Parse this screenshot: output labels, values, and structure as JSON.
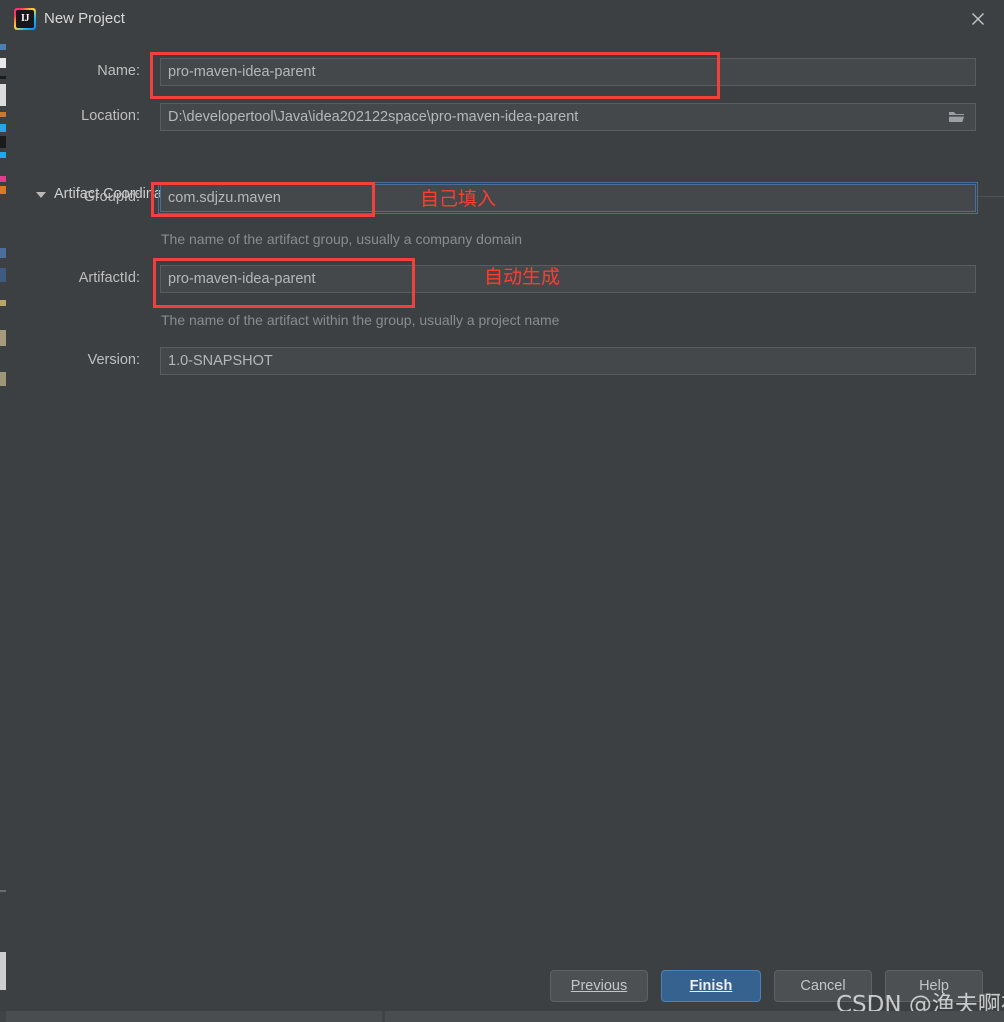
{
  "window": {
    "title": "New Project",
    "logo_icon": "intellij-idea-logo",
    "close_icon": "close-icon"
  },
  "form": {
    "name": {
      "label": "Name:",
      "value": "pro-maven-idea-parent"
    },
    "location": {
      "label": "Location:",
      "value": "D:\\developertool\\Java\\idea202122space\\pro-maven-idea-parent",
      "browse_icon": "folder-icon"
    },
    "section": {
      "title": "Artifact Coordinates",
      "collapse_icon": "chevron-down-icon",
      "expanded": true
    },
    "group_id": {
      "label": "GroupId:",
      "value": "com.sdjzu.maven",
      "hint": "The name of the artifact group, usually a company domain",
      "focused": true
    },
    "artifact_id": {
      "label": "ArtifactId:",
      "value": "pro-maven-idea-parent",
      "hint": "The name of the artifact within the group, usually a project name"
    },
    "version": {
      "label": "Version:",
      "value": "1.0-SNAPSHOT"
    }
  },
  "annotations": [
    {
      "text": "自己填入",
      "note_for": "group-id"
    },
    {
      "text": "自动生成",
      "note_for": "artifact-id"
    }
  ],
  "buttons": {
    "previous": {
      "label": "Previous",
      "mnemonic": "P"
    },
    "finish": {
      "label": "Finish",
      "mnemonic": "F",
      "primary": true
    },
    "cancel": {
      "label": "Cancel",
      "mnemonic": ""
    },
    "help": {
      "label": "Help",
      "mnemonic": ""
    }
  },
  "watermark": {
    "text": "CSDN @渔夫啊布"
  },
  "colors": {
    "dialog_bg": "#3c4043",
    "field_bg": "#45484a",
    "field_border": "#5a5d5f",
    "focus_border": "#4d6e94",
    "primary_button": "#36628f",
    "annotation_red": "#fc3d33",
    "redbox": "#f2413c",
    "text": "#bfbfbf",
    "hint_text": "#898d8f"
  }
}
